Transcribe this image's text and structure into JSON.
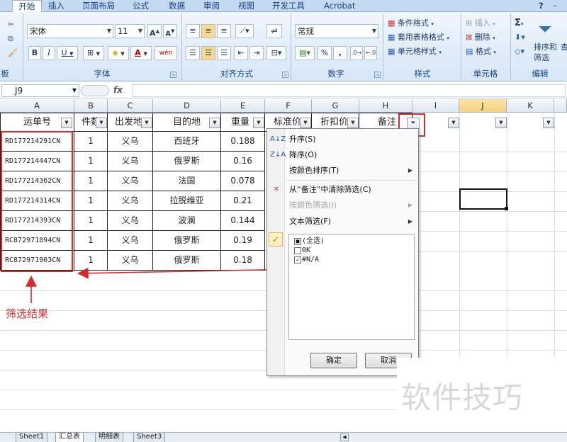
{
  "ribbon": {
    "tabs": [
      "开始",
      "插入",
      "页面布局",
      "公式",
      "数据",
      "审阅",
      "视图",
      "开发工具",
      "Acrobat"
    ],
    "active_tab": "开始",
    "groups": {
      "clipboard": "板",
      "font": "字体",
      "alignment": "对齐方式",
      "number": "数字",
      "styles": "样式",
      "cells": "单元格",
      "editing": "编辑"
    },
    "font_name": "宋体",
    "font_size": "11",
    "grow_font": "A",
    "shrink_font": "A",
    "bold": "B",
    "italic": "I",
    "underline": "U",
    "number_format": "常规",
    "percent": "%",
    "comma": ",",
    "wen": "wén",
    "conditional_format": "条件格式",
    "table_format": "套用表格格式",
    "cell_styles": "单元格样式",
    "insert": "插入",
    "delete": "删除",
    "format": "格式",
    "sort_filter": "排序和",
    "sort_filter2": "筛选",
    "find_select": "查",
    "sigma": "Σ"
  },
  "formula_bar": {
    "name_box": "J9",
    "fx": "fx",
    "value": ""
  },
  "columns": [
    "A",
    "B",
    "C",
    "D",
    "E",
    "F",
    "G",
    "H",
    "I",
    "J",
    "K"
  ],
  "selected_column": "J",
  "headers": [
    "运单号",
    "件数",
    "出发地",
    "目的地",
    "重量",
    "标准价",
    "折扣价",
    "备注"
  ],
  "rows": [
    [
      "RD177214291CN",
      "1",
      "义乌",
      "西班牙",
      "0.188"
    ],
    [
      "RD177214447CN",
      "1",
      "义乌",
      "俄罗斯",
      "0.16"
    ],
    [
      "RD177214362CN",
      "1",
      "义乌",
      "法国",
      "0.078"
    ],
    [
      "RD177214314CN",
      "1",
      "义乌",
      "拉脱维亚",
      "0.21"
    ],
    [
      "RD177214393CN",
      "1",
      "义乌",
      "波澜",
      "0.144"
    ],
    [
      "RC872971894CN",
      "1",
      "义乌",
      "俄罗斯",
      "0.19"
    ],
    [
      "RC872971903CN",
      "1",
      "义乌",
      "俄罗斯",
      "0.18"
    ]
  ],
  "filter_menu": {
    "sort_asc": "升序(S)",
    "sort_desc": "降序(O)",
    "sort_by_color": "按颜色排序(T)",
    "clear_filter": "从“备注”中清除筛选(C)",
    "filter_by_color": "按颜色筛选(I)",
    "text_filter": "文本筛选(F)",
    "list_items": [
      {
        "label": "(全选)",
        "state": "mixed"
      },
      {
        "label": "0K",
        "state": "unchecked"
      },
      {
        "label": "#N/A",
        "state": "checked"
      }
    ],
    "ok": "确定",
    "cancel": "取消"
  },
  "annotation": "筛选结果",
  "watermark": "软件技巧",
  "sheet_tabs": [
    "Sheet1",
    "汇总表",
    "明细表",
    "Sheet3"
  ],
  "active_sheet": "汇总表",
  "colors": {
    "annotation_red": "#d42b2b",
    "ribbon_blue": "#15428b",
    "selected_col": "#f8d27c"
  }
}
